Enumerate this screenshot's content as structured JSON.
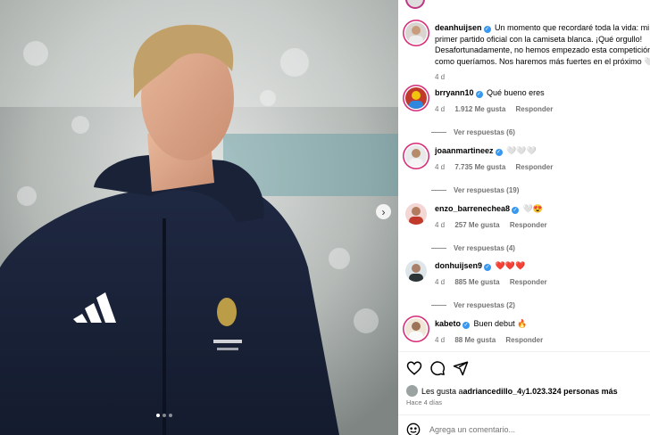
{
  "post": {
    "image_label": "Real Madrid training jacket photo",
    "carousel": {
      "slide_count": 3,
      "active_slide": 1
    }
  },
  "caption": {
    "username": "deanhuijsen",
    "text": "Un momento que recordaré toda la vida: mi primer partido oficial con la camiseta blanca. ¡Qué orgullo! Desafortunadamente, no hemos empezado esta competición como queríamos. Nos haremos más fuertes en el próximo 🤍",
    "time": "4 d"
  },
  "comments": [
    {
      "username": "brryann10",
      "text": "Qué bueno eres",
      "time": "4 d",
      "likes": "1.912 Me gusta",
      "reply": "Responder",
      "view_replies": "Ver respuestas (6)"
    },
    {
      "username": "joaanmartineez",
      "text": "🤍🤍🤍",
      "time": "4 d",
      "likes": "7.735 Me gusta",
      "reply": "Responder",
      "view_replies": "Ver respuestas (19)"
    },
    {
      "username": "enzo_barrenechea8",
      "text": "🤍😍",
      "time": "4 d",
      "likes": "257 Me gusta",
      "reply": "Responder",
      "view_replies": "Ver respuestas (4)"
    },
    {
      "username": "donhuijsen9",
      "text": "❤️❤️❤️",
      "time": "4 d",
      "likes": "885 Me gusta",
      "reply": "Responder",
      "view_replies": "Ver respuestas (2)"
    },
    {
      "username": "kabeto",
      "text": "Buen debut 🔥",
      "time": "4 d",
      "likes": "88 Me gusta",
      "reply": "Responder",
      "view_replies": ""
    }
  ],
  "likes_line": {
    "prefix": "Les gusta a ",
    "user": "adriancedillo_4",
    "mid": " y ",
    "others": "1.023.324 personas más"
  },
  "posted_ago": "Hace 4 días",
  "comment_input": {
    "placeholder": "Agrega un comentario..."
  },
  "icons": [
    "heart-icon",
    "comment-icon",
    "share-icon",
    "emoji-icon",
    "verified-icon",
    "chevron-right-icon"
  ],
  "colors": {
    "verified": "#3897f0",
    "story_ring": "#d62976",
    "muted": "#737373"
  }
}
